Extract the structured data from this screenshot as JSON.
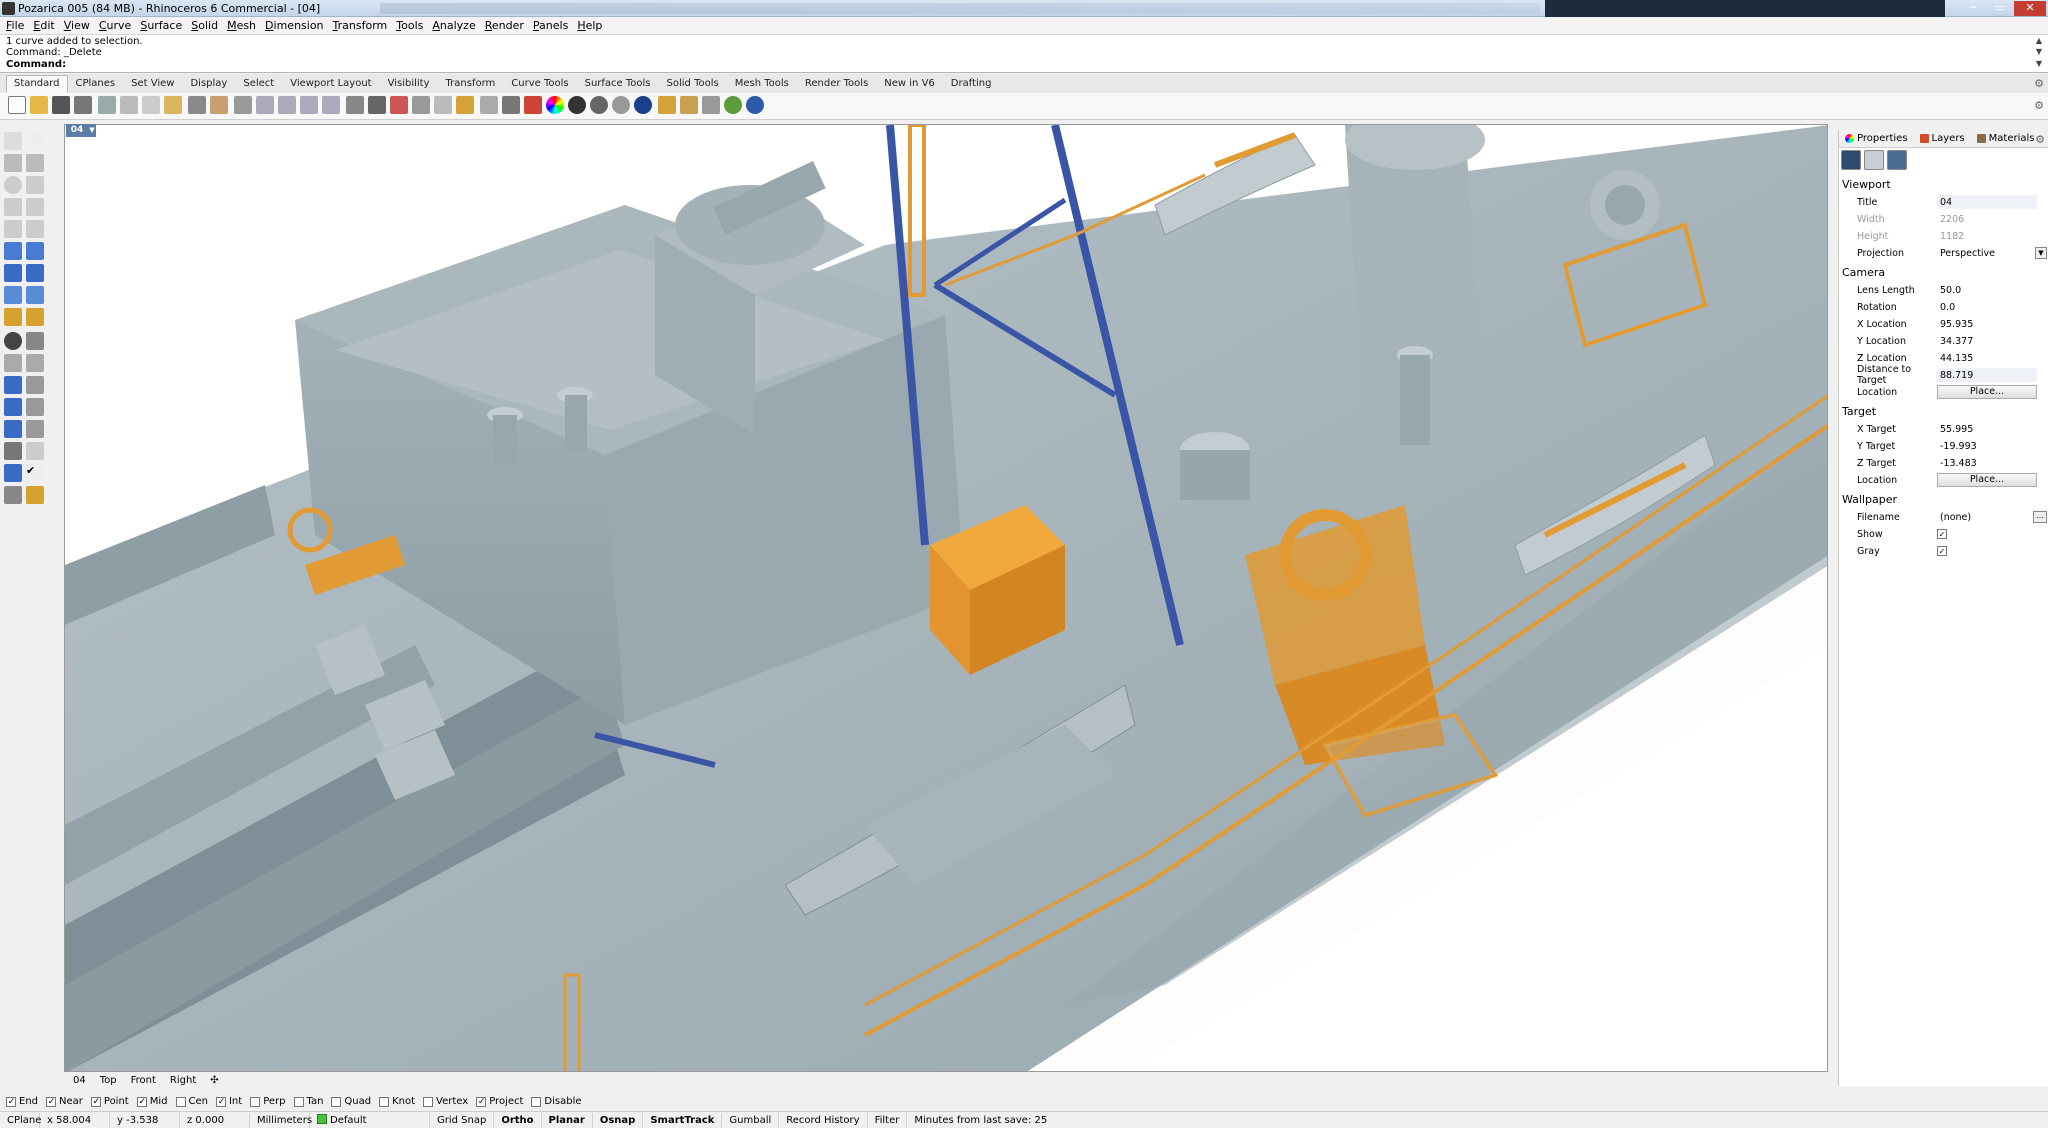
{
  "window": {
    "title": "Pozarica 005 (84 MB) - Rhinoceros 6 Commercial - [04]"
  },
  "menu": [
    "File",
    "Edit",
    "View",
    "Curve",
    "Surface",
    "Solid",
    "Mesh",
    "Dimension",
    "Transform",
    "Tools",
    "Analyze",
    "Render",
    "Panels",
    "Help"
  ],
  "command": {
    "history1": "1 curve added to selection.",
    "history2": "Command: _Delete",
    "prompt": "Command:",
    "input_value": ""
  },
  "toolbar_tabs": [
    "Standard",
    "CPlanes",
    "Set View",
    "Display",
    "Select",
    "Viewport Layout",
    "Visibility",
    "Transform",
    "Curve Tools",
    "Surface Tools",
    "Solid Tools",
    "Mesh Tools",
    "Render Tools",
    "New in V6",
    "Drafting"
  ],
  "viewport": {
    "active_label": "04",
    "tabs": [
      "04",
      "Top",
      "Front",
      "Right"
    ],
    "add_tab": "✣"
  },
  "osnaps": [
    {
      "label": "End",
      "on": true
    },
    {
      "label": "Near",
      "on": true
    },
    {
      "label": "Point",
      "on": true
    },
    {
      "label": "Mid",
      "on": true
    },
    {
      "label": "Cen",
      "on": false
    },
    {
      "label": "Int",
      "on": true
    },
    {
      "label": "Perp",
      "on": false
    },
    {
      "label": "Tan",
      "on": false
    },
    {
      "label": "Quad",
      "on": false
    },
    {
      "label": "Knot",
      "on": false
    },
    {
      "label": "Vertex",
      "on": false
    },
    {
      "label": "Project",
      "on": true
    },
    {
      "label": "Disable",
      "on": false
    }
  ],
  "status": {
    "cplane": "CPlane",
    "x": "x 58.004",
    "y": "y -3.538",
    "z": "z 0.000",
    "units": "Millimeters",
    "layer": "Default",
    "grid_snap": "Grid Snap",
    "ortho": "Ortho",
    "planar": "Planar",
    "osnap": "Osnap",
    "smarttrack": "SmartTrack",
    "gumball": "Gumball",
    "record_history": "Record History",
    "filter": "Filter",
    "last_save": "Minutes from last save: 25"
  },
  "panel": {
    "tabs": [
      "Properties",
      "Layers",
      "Materials"
    ],
    "viewport_section": "Viewport",
    "title_label": "Title",
    "title_value": "04",
    "width_label": "Width",
    "width_value": "2206",
    "height_label": "Height",
    "height_value": "1182",
    "projection_label": "Projection",
    "projection_value": "Perspective",
    "camera_section": "Camera",
    "lens_label": "Lens Length",
    "lens_value": "50.0",
    "rotation_label": "Rotation",
    "rotation_value": "0.0",
    "xloc_label": "X Location",
    "xloc_value": "95.935",
    "yloc_label": "Y Location",
    "yloc_value": "34.377",
    "zloc_label": "Z Location",
    "zloc_value": "44.135",
    "dist_label": "Distance to Target",
    "dist_value": "88.719",
    "camloc_label": "Location",
    "camloc_button": "Place...",
    "target_section": "Target",
    "xt_label": "X Target",
    "xt_value": "55.995",
    "yt_label": "Y Target",
    "yt_value": "-19.993",
    "zt_label": "Z Target",
    "zt_value": "-13.483",
    "tloc_label": "Location",
    "tloc_button": "Place...",
    "wallpaper_section": "Wallpaper",
    "filename_label": "Filename",
    "filename_value": "(none)",
    "show_label": "Show",
    "show_checked": true,
    "gray_label": "Gray",
    "gray_checked": true
  },
  "colors": {
    "hull": "#a9b6bd",
    "hull_shadow": "#8a989f",
    "orange": "#e19a34",
    "blue": "#3a55a6",
    "viewport_bg": "#ffffff"
  }
}
